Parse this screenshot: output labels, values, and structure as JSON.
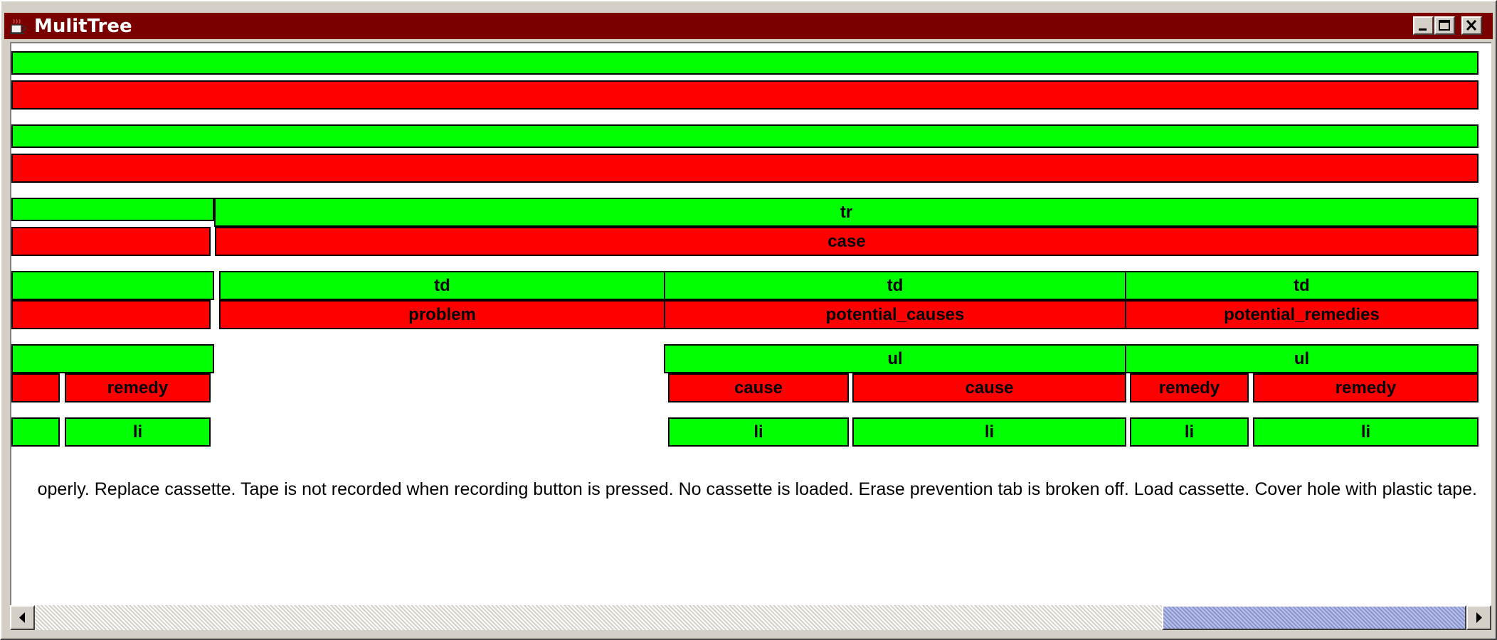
{
  "window": {
    "title": "MulitTree",
    "app_icon": "java-coffee-cup-icon",
    "title_bar_color": "#7a0000",
    "controls": [
      "minimize-icon",
      "maximize-icon",
      "close-icon"
    ]
  },
  "colors": {
    "element_node": "#00ff00",
    "semantic_node": "#ff0000",
    "node_border": "#000000"
  },
  "tree": {
    "row3": {
      "tr_label": "tr",
      "case_label": "case"
    },
    "row4": {
      "td1": "td",
      "td2": "td",
      "td3": "td",
      "problem": "problem",
      "potential_causes": "potential_causes",
      "potential_remedies": "potential_remedies"
    },
    "row5": {
      "remedy_left": "remedy",
      "ul1": "ul",
      "ul2": "ul",
      "cause1": "cause",
      "cause2": "cause",
      "remedy1": "remedy",
      "remedy2": "remedy"
    },
    "row6": {
      "li_left": "li",
      "li1": "li",
      "li2": "li",
      "li3": "li",
      "li4": "li"
    }
  },
  "content_text": "operly. Replace cassette.  Tape is not recorded when recording button is pressed. No cassette is loaded. Erase prevention tab is broken off. Load cassette. Cover hole with plastic tape.",
  "scrollbar": {
    "orientation": "horizontal",
    "left_arrow": "left-arrow-icon",
    "right_arrow": "right-arrow-icon",
    "position_fraction": 1.0
  }
}
